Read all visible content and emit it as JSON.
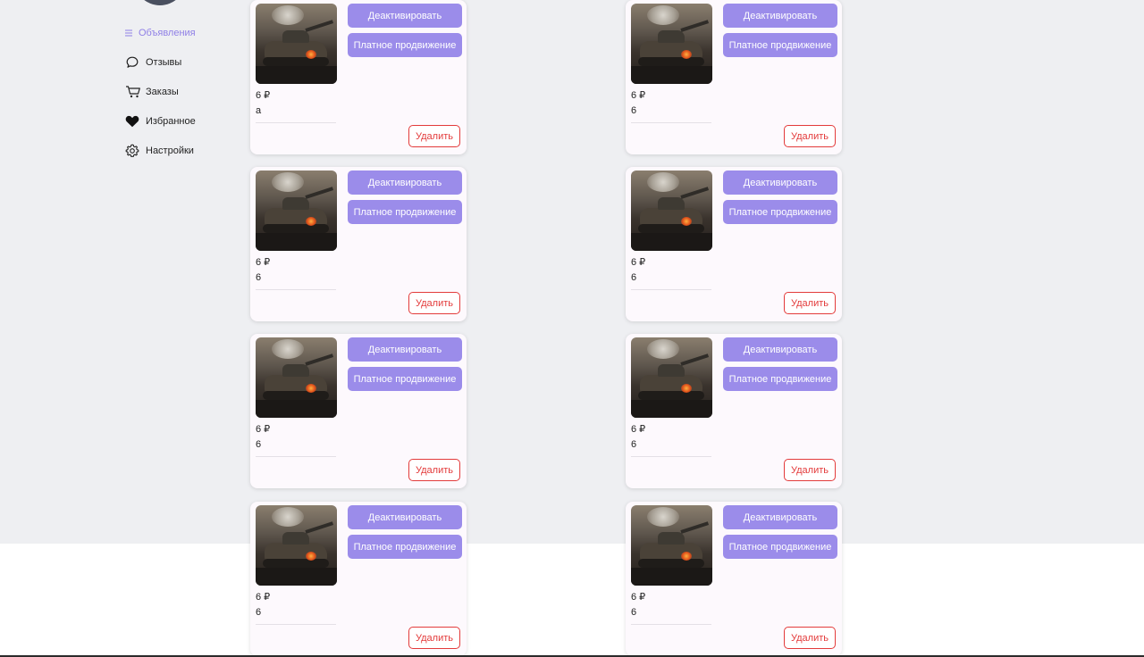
{
  "sidebar": {
    "items": [
      {
        "label": "Объявления",
        "icon": "list-icon",
        "active": true
      },
      {
        "label": "Отзывы",
        "icon": "chat-icon"
      },
      {
        "label": "Заказы",
        "icon": "cart-icon"
      },
      {
        "label": "Избранное",
        "icon": "heart-icon"
      },
      {
        "label": "Настройки",
        "icon": "gear-icon"
      }
    ]
  },
  "ads": [
    {
      "price": "6 ₽",
      "title": "a"
    },
    {
      "price": "6 ₽",
      "title": "6"
    },
    {
      "price": "6 ₽",
      "title": "6"
    },
    {
      "price": "6 ₽",
      "title": "6"
    },
    {
      "price": "6 ₽",
      "title": "6"
    },
    {
      "price": "6 ₽",
      "title": "6"
    },
    {
      "price": "6 ₽",
      "title": "6"
    },
    {
      "price": "6 ₽",
      "title": "6"
    }
  ],
  "actions": {
    "deactivate": "Деактивировать",
    "promote": "Платное продвижение",
    "delete": "Удалить"
  },
  "colors": {
    "accent": "#9b8cea",
    "danger": "#e33b3b",
    "page_bg": "#eeeff2"
  }
}
